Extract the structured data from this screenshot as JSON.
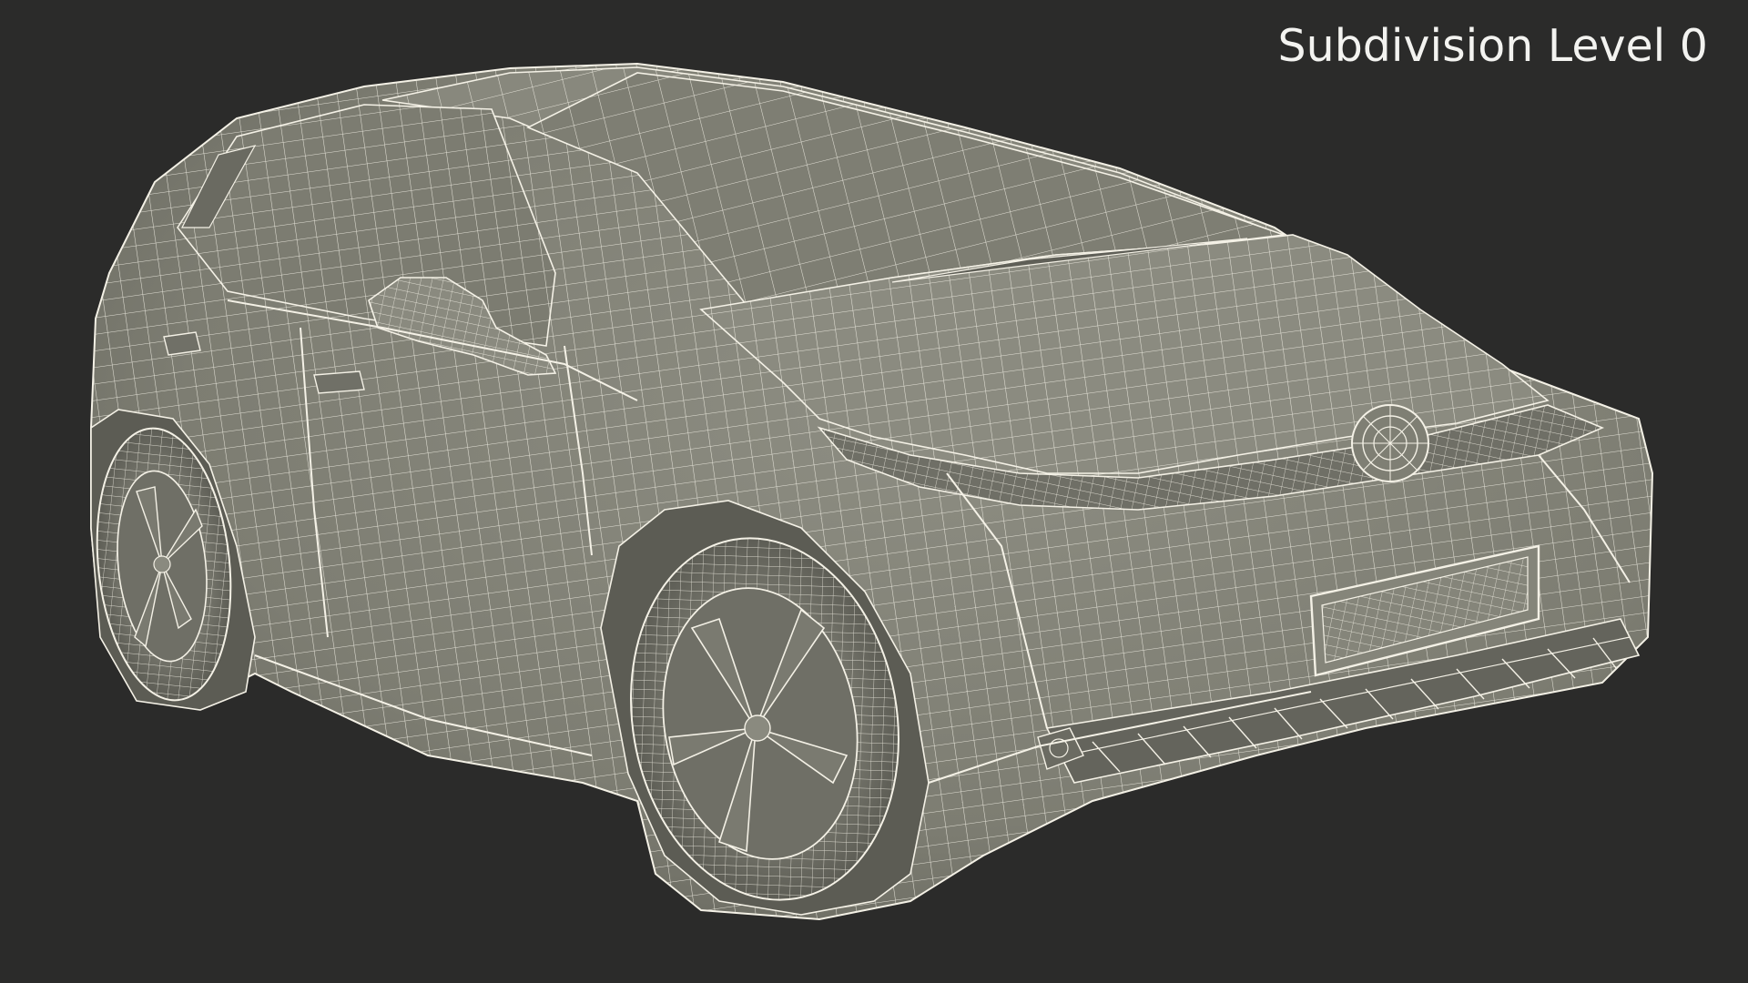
{
  "overlay": {
    "label": "Subdivision Level 0"
  },
  "scene": {
    "subject": "car-wireframe",
    "background_color": "#2b2b2a",
    "body_color": "#85857a",
    "body_dark_color": "#5e5e55",
    "wire_color": "#f4f1e6"
  }
}
